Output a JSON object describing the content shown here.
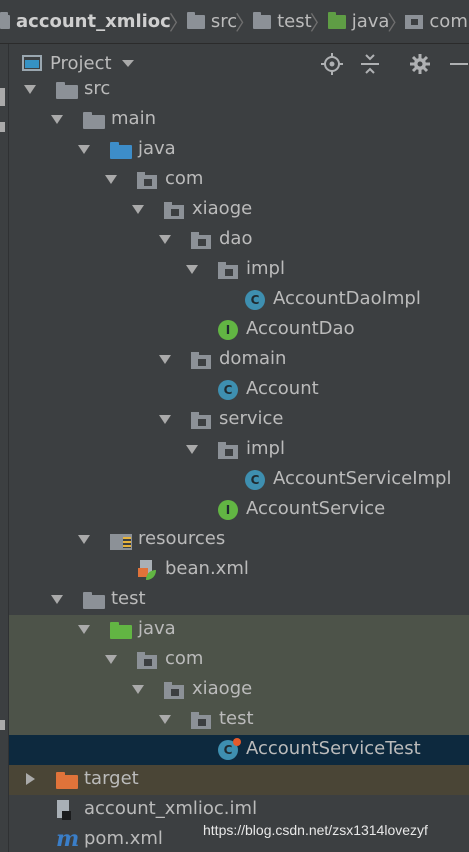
{
  "breadcrumb": [
    "account_xmlioc",
    "src",
    "test",
    "java",
    "com"
  ],
  "toolbar": {
    "project_label": "Project",
    "buttons": [
      "locate-icon",
      "collapse-icon",
      "gear-icon",
      "minimize-icon"
    ]
  },
  "tree": [
    {
      "label": "src",
      "depth": 0,
      "icon": "folder",
      "expanded": true
    },
    {
      "label": "main",
      "depth": 1,
      "icon": "folder",
      "expanded": true
    },
    {
      "label": "java",
      "depth": 2,
      "icon": "source-folder",
      "expanded": true
    },
    {
      "label": "com",
      "depth": 3,
      "icon": "package",
      "expanded": true
    },
    {
      "label": "xiaoge",
      "depth": 4,
      "icon": "package",
      "expanded": true
    },
    {
      "label": "dao",
      "depth": 5,
      "icon": "package",
      "expanded": true
    },
    {
      "label": "impl",
      "depth": 6,
      "icon": "package",
      "expanded": true
    },
    {
      "label": "AccountDaoImpl",
      "depth": 7,
      "icon": "class"
    },
    {
      "label": "AccountDao",
      "depth": 6,
      "icon": "interface"
    },
    {
      "label": "domain",
      "depth": 5,
      "icon": "package",
      "expanded": true
    },
    {
      "label": "Account",
      "depth": 6,
      "icon": "class"
    },
    {
      "label": "service",
      "depth": 5,
      "icon": "package",
      "expanded": true
    },
    {
      "label": "impl",
      "depth": 6,
      "icon": "package",
      "expanded": true
    },
    {
      "label": "AccountServiceImpl",
      "depth": 7,
      "icon": "class"
    },
    {
      "label": "AccountService",
      "depth": 6,
      "icon": "interface"
    },
    {
      "label": "resources",
      "depth": 2,
      "icon": "resources-folder",
      "expanded": true
    },
    {
      "label": "bean.xml",
      "depth": 3,
      "icon": "xml-file"
    },
    {
      "label": "test",
      "depth": 1,
      "icon": "folder",
      "expanded": true
    },
    {
      "label": "java",
      "depth": 2,
      "icon": "test-folder",
      "expanded": true
    },
    {
      "label": "com",
      "depth": 3,
      "icon": "package",
      "expanded": true
    },
    {
      "label": "xiaoge",
      "depth": 4,
      "icon": "package",
      "expanded": true
    },
    {
      "label": "test",
      "depth": 5,
      "icon": "package",
      "expanded": true
    },
    {
      "label": "AccountServiceTest",
      "depth": 6,
      "icon": "test-class",
      "selected": true
    },
    {
      "label": "target",
      "depth": 0,
      "icon": "excluded-folder",
      "expanded": false
    },
    {
      "label": "account_xmlioc.iml",
      "depth": 0,
      "icon": "iml-file"
    },
    {
      "label": "pom.xml",
      "depth": 0,
      "icon": "maven-file"
    }
  ],
  "watermark": "https://blog.csdn.net/zsx1314lovezyf",
  "colors": {
    "selected_row": "#0d293e",
    "test_highlight": "#4d5349",
    "excluded_highlight": "#4a4536"
  }
}
